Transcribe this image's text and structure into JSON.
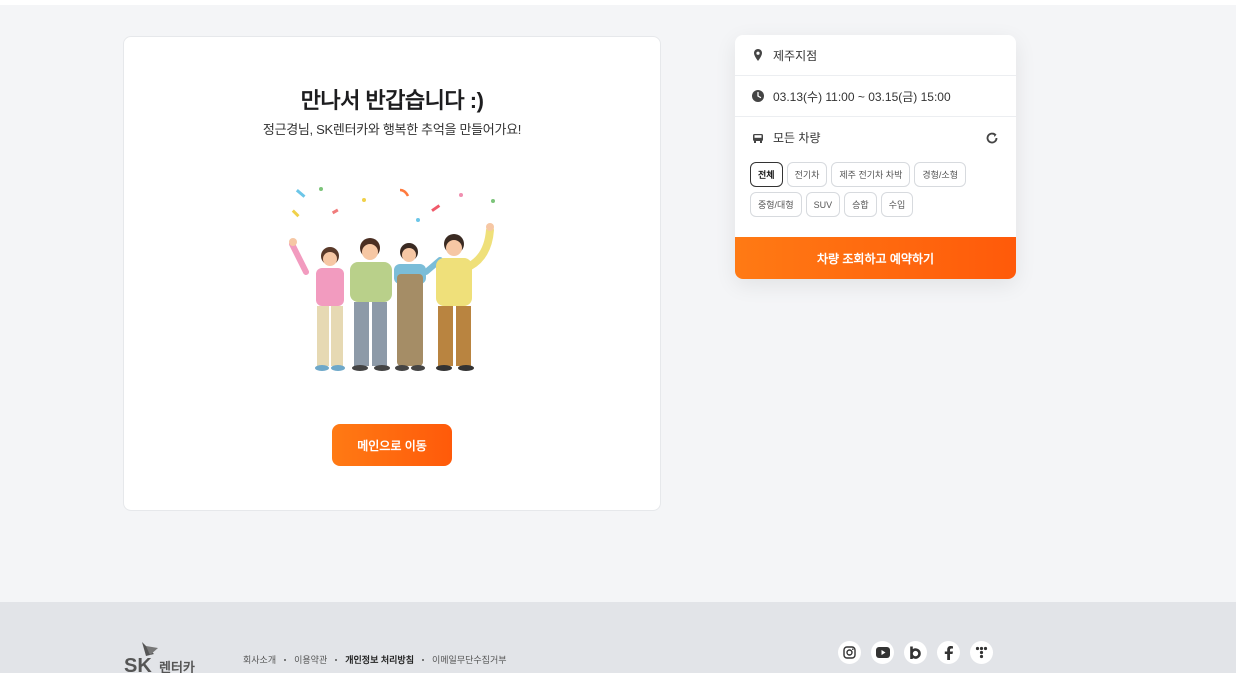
{
  "welcome": {
    "title": "만나서 반갑습니다 :)",
    "subtitle": "정근경님, SK렌터카와 행복한 추억을 만들어가요!",
    "main_button": "메인으로 이동"
  },
  "reservation": {
    "branch": "제주지점",
    "datetime": "03.13(수) 11:00 ~ 03.15(금) 15:00",
    "car_filter_label": "모든 차량",
    "chips_row1": [
      "전체",
      "전기차",
      "제주 전기차 차박",
      "경형/소형"
    ],
    "chips_row2": [
      "중형/대형",
      "SUV",
      "승합",
      "수입"
    ],
    "active_chip": "전체",
    "search_button": "차량 조회하고 예약하기"
  },
  "footer": {
    "logo_text": "SK 렌터카",
    "links": [
      "회사소개",
      "이용약관",
      "개인정보 처리방침",
      "이메일무단수집거부"
    ],
    "social_icons": [
      "instagram-icon",
      "youtube-icon",
      "blog-icon",
      "facebook-icon",
      "kakao-story-icon"
    ]
  },
  "colors": {
    "accent": "#ff6a0f",
    "background": "#f4f5f7",
    "footer_bg": "#e2e4e8"
  }
}
